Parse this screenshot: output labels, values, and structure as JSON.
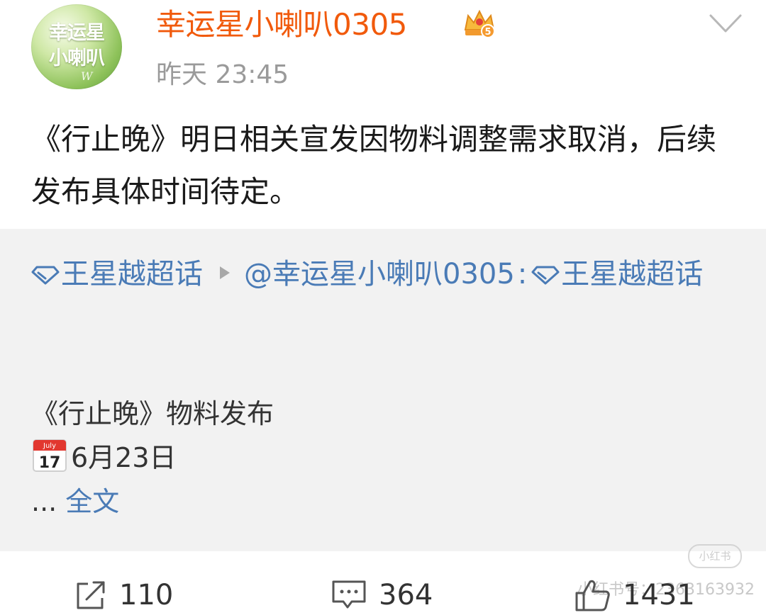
{
  "header": {
    "avatar_text_line1": "幸运星",
    "avatar_text_line2": "小喇叭",
    "avatar_signature": "W",
    "username": "幸运星小喇叭0305",
    "vip_level": "5",
    "timestamp": "昨天 23:45",
    "icons": {
      "dropdown": "chevron-down-icon",
      "vip": "crown-badge-icon"
    }
  },
  "post": {
    "text": "《行止晚》明日相关宣发因物料调整需求取消，后续发布具体时间待定。"
  },
  "repost": {
    "topic1": "王星越超话",
    "mention": "@幸运星小喇叭0305",
    "colon": ":",
    "topic2": "王星越超话",
    "line1": "《行止晚》物料发布",
    "calendar_month": "July",
    "calendar_day": "17",
    "date": "6月23日",
    "ellipsis": "...",
    "fulltext": "全文"
  },
  "watermark": {
    "badge": "小红书",
    "text": "小红书号：2363163932"
  },
  "actions": {
    "reposts": "110",
    "comments": "364",
    "likes": "1431"
  },
  "colors": {
    "username": "#f15a0c",
    "link": "#4a7bb6",
    "repost_bg": "#f2f2f2",
    "timestamp": "#9a9a9a"
  }
}
